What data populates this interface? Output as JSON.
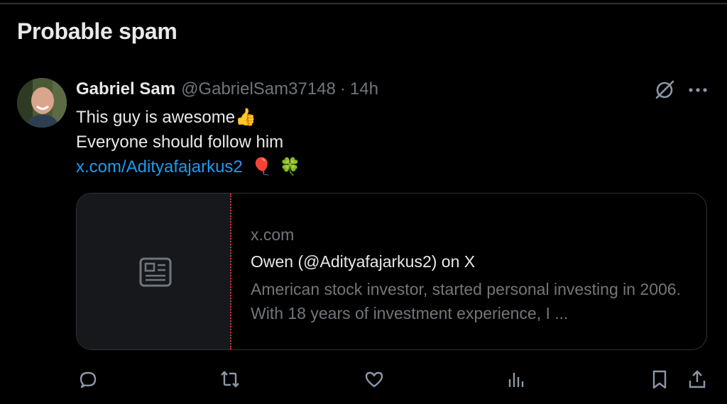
{
  "section": {
    "title": "Probable spam"
  },
  "post": {
    "author_name": "Gabriel Sam",
    "author_handle": "@GabrielSam37148",
    "separator": "·",
    "timestamp": "14h",
    "text_line_1": "This guy is awesome",
    "text_line_1_emoji": "👍",
    "text_line_2": "Everyone should follow him",
    "link_text": "x.com/Adityafajarkus2",
    "trailing_emojis": [
      "🎈",
      "🍀"
    ]
  },
  "link_card": {
    "domain": "x.com",
    "title": "Owen (@Adityafajarkus2) on X",
    "description": "American stock investor, started personal investing in 2006. With 18 years of investment experience, I ..."
  },
  "icons": {
    "header": [
      "grok-icon",
      "more-icon"
    ],
    "actions": [
      "reply-icon",
      "repost-icon",
      "like-icon",
      "views-icon",
      "bookmark-icon",
      "share-icon"
    ]
  },
  "colors": {
    "background": "#000000",
    "text_primary": "#e7e9ea",
    "text_secondary": "#71767b",
    "link": "#1d9bf0",
    "border": "#2f3336"
  }
}
